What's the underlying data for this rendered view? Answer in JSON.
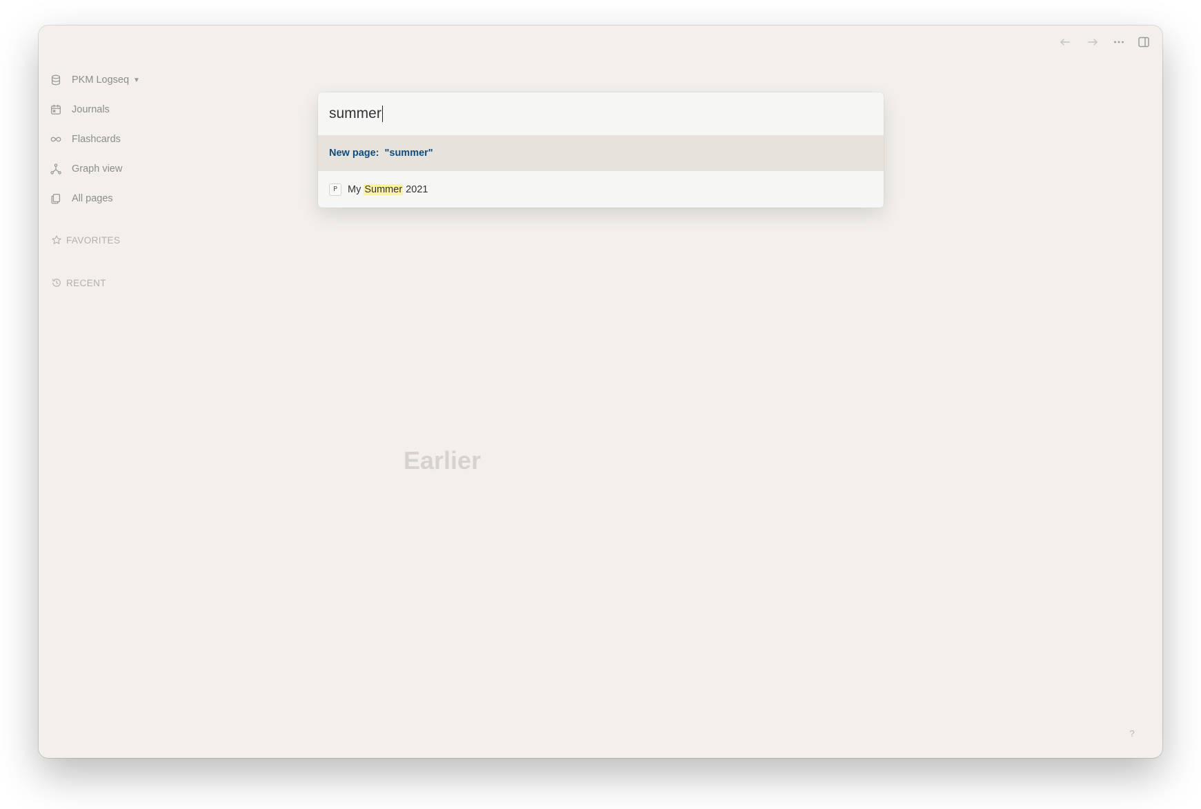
{
  "sidebar": {
    "graph_name": "PKM Logseq",
    "items": [
      {
        "label": "Journals",
        "icon": "calendar-icon"
      },
      {
        "label": "Flashcards",
        "icon": "infinity-icon"
      },
      {
        "label": "Graph view",
        "icon": "graph-icon"
      },
      {
        "label": "All pages",
        "icon": "pages-icon"
      }
    ],
    "favorites_label": "FAVORITES",
    "recent_label": "RECENT"
  },
  "search": {
    "query": "summer",
    "new_page_prefix": "New page:",
    "new_page_value": "\"summer\"",
    "results": [
      {
        "badge": "P",
        "before": "My ",
        "match": "Summer",
        "after": " 2021"
      }
    ]
  },
  "main": {
    "earlier_label": "Earlier"
  },
  "help_label": "?"
}
